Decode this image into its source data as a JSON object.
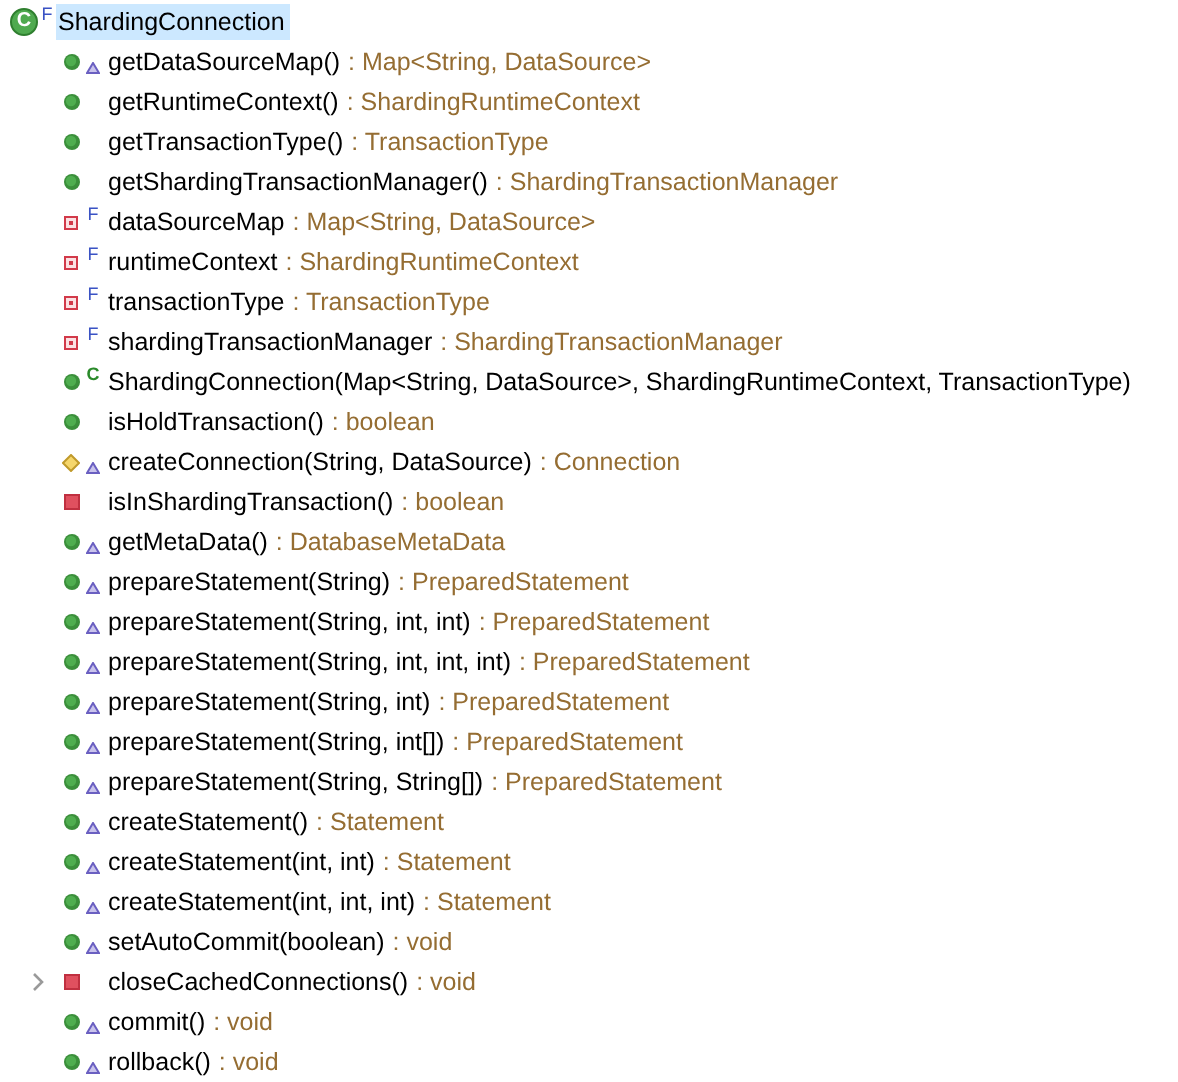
{
  "outline": {
    "class": {
      "icon_letter": "C",
      "name": "ShardingConnection",
      "modifier": "F",
      "selected": true
    },
    "members": [
      {
        "kind": "public_method",
        "overrides": true,
        "name": "getDataSourceMap()",
        "type": ": Map<String, DataSource>"
      },
      {
        "kind": "public_method",
        "overrides": false,
        "name": "getRuntimeContext()",
        "type": ": ShardingRuntimeContext"
      },
      {
        "kind": "public_method",
        "overrides": false,
        "name": "getTransactionType()",
        "type": ": TransactionType"
      },
      {
        "kind": "public_method",
        "overrides": false,
        "name": "getShardingTransactionManager()",
        "type": ": ShardingTransactionManager"
      },
      {
        "kind": "private_field",
        "overrides": false,
        "modifier": "F",
        "name": "dataSourceMap",
        "type": ": Map<String, DataSource>"
      },
      {
        "kind": "private_field",
        "overrides": false,
        "modifier": "F",
        "name": "runtimeContext",
        "type": ": ShardingRuntimeContext"
      },
      {
        "kind": "private_field",
        "overrides": false,
        "modifier": "F",
        "name": "transactionType",
        "type": ": TransactionType"
      },
      {
        "kind": "private_field",
        "overrides": false,
        "modifier": "F",
        "name": "shardingTransactionManager",
        "type": ": ShardingTransactionManager"
      },
      {
        "kind": "constructor",
        "overrides": false,
        "modifier": "C",
        "name": "ShardingConnection(Map<String, DataSource>, ShardingRuntimeContext, TransactionType)"
      },
      {
        "kind": "public_method",
        "overrides": false,
        "name": "isHoldTransaction()",
        "type": ": boolean"
      },
      {
        "kind": "default_method",
        "overrides": true,
        "name": "createConnection(String, DataSource)",
        "type": ": Connection"
      },
      {
        "kind": "private_method",
        "overrides": false,
        "name": "isInShardingTransaction()",
        "type": ": boolean"
      },
      {
        "kind": "public_method",
        "overrides": true,
        "name": "getMetaData()",
        "type": ": DatabaseMetaData"
      },
      {
        "kind": "public_method",
        "overrides": true,
        "name": "prepareStatement(String)",
        "type": ": PreparedStatement"
      },
      {
        "kind": "public_method",
        "overrides": true,
        "name": "prepareStatement(String, int, int)",
        "type": ": PreparedStatement"
      },
      {
        "kind": "public_method",
        "overrides": true,
        "name": "prepareStatement(String, int, int, int)",
        "type": ": PreparedStatement"
      },
      {
        "kind": "public_method",
        "overrides": true,
        "name": "prepareStatement(String, int)",
        "type": ": PreparedStatement"
      },
      {
        "kind": "public_method",
        "overrides": true,
        "name": "prepareStatement(String, int[])",
        "type": ": PreparedStatement"
      },
      {
        "kind": "public_method",
        "overrides": true,
        "name": "prepareStatement(String, String[])",
        "type": ": PreparedStatement"
      },
      {
        "kind": "public_method",
        "overrides": true,
        "name": "createStatement()",
        "type": ": Statement"
      },
      {
        "kind": "public_method",
        "overrides": true,
        "name": "createStatement(int, int)",
        "type": ": Statement"
      },
      {
        "kind": "public_method",
        "overrides": true,
        "name": "createStatement(int, int, int)",
        "type": ": Statement"
      },
      {
        "kind": "public_method",
        "overrides": true,
        "name": "setAutoCommit(boolean)",
        "type": ": void"
      },
      {
        "kind": "private_method",
        "overrides": false,
        "expandable": true,
        "name": "closeCachedConnections()",
        "type": ": void"
      },
      {
        "kind": "public_method",
        "overrides": true,
        "name": "commit()",
        "type": ": void"
      },
      {
        "kind": "public_method",
        "overrides": true,
        "name": "rollback()",
        "type": ": void"
      }
    ]
  }
}
